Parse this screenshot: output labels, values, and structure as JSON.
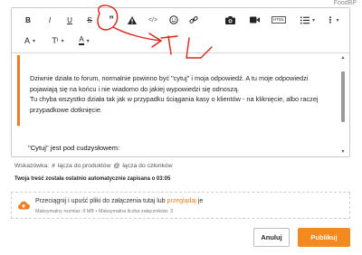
{
  "header": {
    "corner_text": "FoodBP"
  },
  "toolbar": {
    "row1": [
      "bold-icon",
      "italic-icon",
      "underline-icon",
      "strikethrough-icon",
      "quote-icon",
      "warning-icon",
      "code-icon",
      "emoji-icon",
      "link-icon",
      "image-icon",
      "video-icon",
      "html-icon",
      "list-icon",
      "more-icon"
    ],
    "html_label": "HTML",
    "font_size_label": "A",
    "text_style_label": "T",
    "text_color_label": "A"
  },
  "editor": {
    "quote_paragraphs": [
      "Dziwnie działa to forum, normalnie powinno być \"cytuj\" i moja odpowiedź. A tu moje odpowiedzi pojawiają się na końcu i nie wiadomo do jakiej wypowiedzi się odnoszą.",
      "Tu chyba wszystko działa tak jak w przypadku ściągania kasy o klientów - na kliknięcie, albo raczej przypadkowe dotknięcie."
    ],
    "after_quote_text": "\"Cytuj\" jest pod cudzysłowem:"
  },
  "hints": {
    "prefix": "Wskazówka:",
    "hash_link": "łącza do produktów",
    "mention_link": "łącza do członków"
  },
  "autosave": "Twoja treść została ostatnio automatycznie zapisana o 03:05",
  "upload": {
    "main_text": "Przeciągnij i upuść pliki do załączenia tutaj lub",
    "link_text": "przeglądaj",
    "suffix": "je",
    "sub_text": "Maksymalny rozmiar: 9 MB • Maksymalna liczba załączników: 3"
  },
  "buttons": {
    "cancel": "Anuluj",
    "publish": "Publikuj"
  },
  "colors": {
    "accent": "#f07d20",
    "publish_bg": "#f28a1f",
    "annotation": "#e2231a"
  }
}
